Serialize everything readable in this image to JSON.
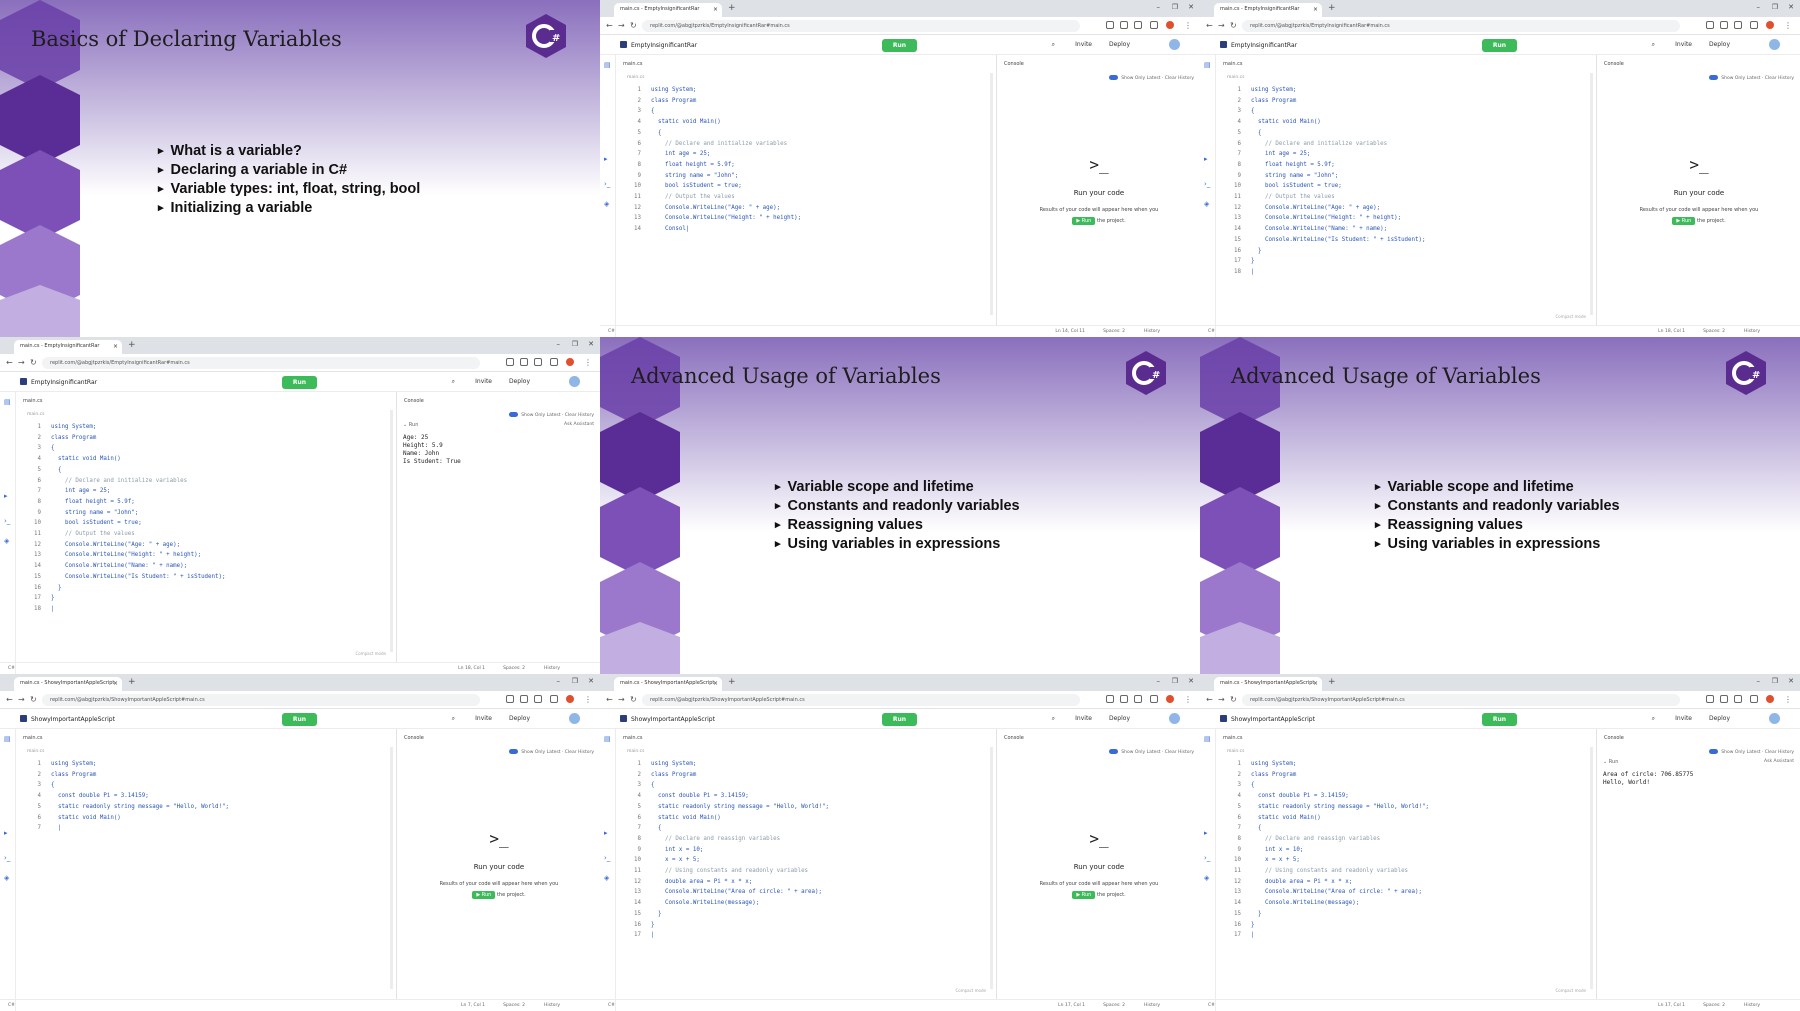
{
  "slides": {
    "basics": {
      "title": "Basics of Declaring Variables",
      "bullets": [
        "What is a variable?",
        "Declaring a variable in C#",
        "Variable types: int, float, string, bool",
        "Initializing a variable"
      ],
      "logo": "C#"
    },
    "advanced": {
      "title": "Advanced Usage of Variables",
      "bullets": [
        "Variable scope and lifetime",
        "Constants and readonly variables",
        "Reassigning values",
        "Using variables in expressions"
      ],
      "logo": "C#"
    }
  },
  "browser": {
    "tab_title_a": "main.cs - EmptyInsignificantRar",
    "tab_title_b": "main.cs - ShowyImportantAppleScript",
    "url_a": "replit.com/@abgjtpzrkis/EmptyInsignificantRar#main.cs",
    "url_b": "replit.com/@abgjtpzrkis/ShowyImportantAppleScript#main.cs",
    "project_a": "EmptyInsignificantRar",
    "project_b": "ShowyImportantAppleScript",
    "run": "Run",
    "invite": "Invite",
    "deploy": "Deploy",
    "editor_tab": "main.cs",
    "file_label": "main.cs",
    "console_tab": "Console",
    "show_only_latest": "Show Only Latest",
    "clear_history": "Clear History",
    "run_your_code": "Run your code",
    "results_hint": "Results of your code will appear here when you",
    "the_project": "the project.",
    "ask_assistant": "Ask Assistant",
    "status_left": "C#",
    "status_history": "History",
    "status_spaces": "Spaces: 2",
    "compact": "Compact mode"
  },
  "code": {
    "v1": [
      "using System;",
      "class Program",
      "{",
      "  static void Main()",
      "  {",
      "    // Declare and initialize variables",
      "    int age = 25;",
      "    float height = 5.9f;",
      "    string name = \"John\";",
      "    bool isStudent = true;",
      "    // Output the values",
      "    Console.WriteLine(\"Age: \" + age);",
      "    Console.WriteLine(\"Height: \" + height);",
      "    Consol|"
    ],
    "v2": [
      "using System;",
      "class Program",
      "{",
      "  static void Main()",
      "  {",
      "    // Declare and initialize variables",
      "    int age = 25;",
      "    float height = 5.9f;",
      "    string name = \"John\";",
      "    bool isStudent = true;",
      "    // Output the values",
      "    Console.WriteLine(\"Age: \" + age);",
      "    Console.WriteLine(\"Height: \" + height);",
      "    Console.WriteLine(\"Name: \" + name);",
      "    Console.WriteLine(\"Is Student: \" + isStudent);",
      "  }",
      "}",
      "|"
    ],
    "v3": [
      "using System;",
      "class Program",
      "{",
      "  const double Pi = 3.14159;",
      "  static readonly string message = \"Hello, World!\";",
      "  static void Main()",
      "  |"
    ],
    "v4": [
      "using System;",
      "class Program",
      "{",
      "  const double Pi = 3.14159;",
      "  static readonly string message = \"Hello, World!\";",
      "  static void Main()",
      "  {",
      "    // Declare and reassign variables",
      "    int x = 10;",
      "    x = x + 5;",
      "    // Using constants and readonly variables",
      "    double area = Pi * x * x;",
      "    Console.WriteLine(\"Area of circle: \" + area);",
      "    Console.WriteLine(message);",
      "  }",
      "}",
      "|"
    ]
  },
  "outputs": {
    "o1": "Age: 25\nHeight: 5.9\nName: John\nIs Student: True",
    "o2": "Area of circle: 706.85775\nHello, World!"
  },
  "status": {
    "s1": "Ln 14, Col 11",
    "s2": "Ln 18, Col 1",
    "s3": "Ln 7, Col 1",
    "s4": "Ln 17, Col 1"
  },
  "colors": {
    "run_green": "#3dbb5a",
    "slide_purple": "#6a3fa8",
    "csharp_logo": "#5b2c8f"
  }
}
